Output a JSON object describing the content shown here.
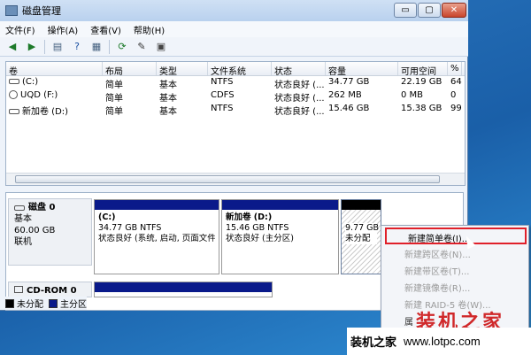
{
  "window": {
    "title": "磁盘管理",
    "min_label": "▭",
    "max_label": "▢",
    "close_label": "✕"
  },
  "menu": [
    "文件(F)",
    "操作(A)",
    "查看(V)",
    "帮助(H)"
  ],
  "toolbar": {
    "icons": [
      "back-arrow-icon",
      "forward-arrow-icon",
      "console-tree-icon",
      "help-icon",
      "properties-icon",
      "refresh-icon",
      "settings-icon",
      "disk-icon"
    ]
  },
  "volumes": {
    "headers": [
      "卷",
      "布局",
      "类型",
      "文件系统",
      "状态",
      "容量",
      "可用空间",
      "%"
    ],
    "rows": [
      [
        "(C:)",
        "简单",
        "基本",
        "NTFS",
        "状态良好 (...",
        "34.77 GB",
        "22.19 GB",
        "64"
      ],
      [
        "UQD (F:)",
        "简单",
        "基本",
        "CDFS",
        "状态良好 (...",
        "262 MB",
        "0 MB",
        "0"
      ],
      [
        "新加卷 (D:)",
        "简单",
        "基本",
        "NTFS",
        "状态良好 (...",
        "15.46 GB",
        "15.38 GB",
        "99"
      ]
    ]
  },
  "disk0": {
    "name": "磁盘 0",
    "type": "基本",
    "size": "60.00 GB",
    "status": "联机",
    "parts": [
      {
        "name": "(C:)",
        "size": "34.77 GB NTFS",
        "status": "状态良好 (系统, 启动, 页面文件"
      },
      {
        "name": "新加卷 (D:)",
        "size": "15.46 GB NTFS",
        "status": "状态良好 (主分区)"
      },
      {
        "name": "",
        "size": "9.77 GB",
        "status": "未分配"
      }
    ]
  },
  "cdrom0": {
    "name": "CD-ROM 0"
  },
  "legend": {
    "unallocated": "未分配",
    "primary": "主分区",
    "colors": {
      "unallocated": "#000000",
      "primary": "#0a1a8a"
    }
  },
  "context_menu": {
    "items": [
      "新建简单卷(I)...",
      "新建跨区卷(N)...",
      "新建带区卷(T)...",
      "新建镜像卷(R)...",
      "新建 RAID-5 卷(W)...",
      "属"
    ],
    "highlight_color": "#e0202a"
  },
  "watermark": {
    "big": "装机之家",
    "small": "装机之家",
    "url": "www.lotpc.com"
  }
}
